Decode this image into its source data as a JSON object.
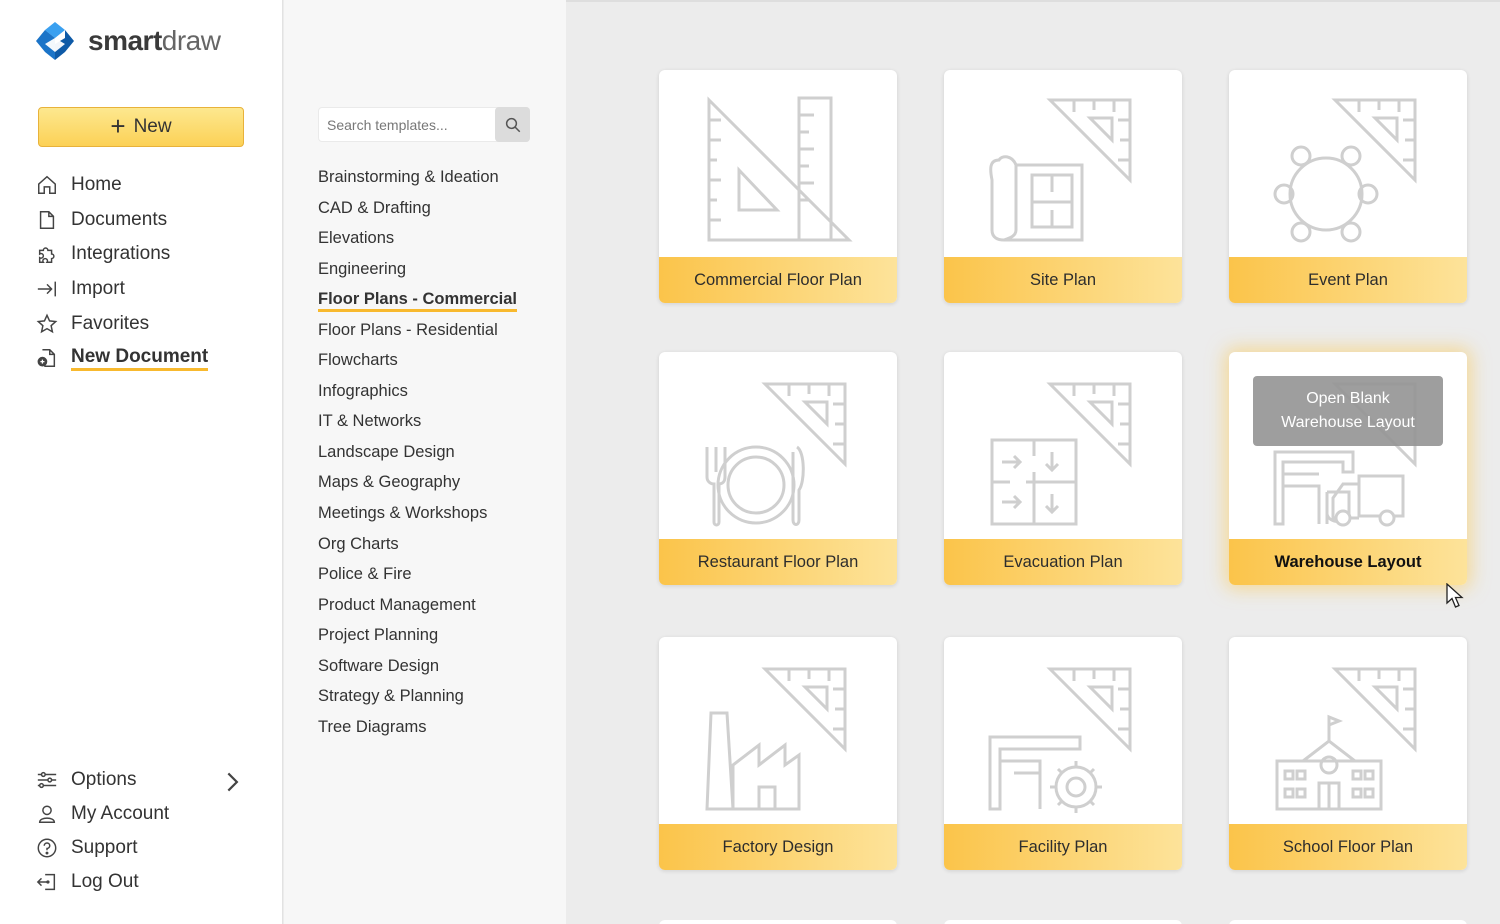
{
  "app": {
    "logo_bold": "smart",
    "logo_light": "draw",
    "brand_colors": {
      "accent": "#fcd156",
      "underline": "#f8b92e",
      "logo_blue": "#1b74c8"
    }
  },
  "sidebar": {
    "new_label": "New",
    "items": [
      {
        "label": "Home",
        "icon": "home-icon"
      },
      {
        "label": "Documents",
        "icon": "document-icon"
      },
      {
        "label": "Integrations",
        "icon": "puzzle-icon"
      },
      {
        "label": "Import",
        "icon": "import-icon"
      },
      {
        "label": "Favorites",
        "icon": "star-icon"
      },
      {
        "label": "New Document",
        "icon": "new-document-icon",
        "active": true
      }
    ],
    "bottom": [
      {
        "label": "Options",
        "icon": "sliders-icon"
      },
      {
        "label": "My Account",
        "icon": "user-icon"
      },
      {
        "label": "Support",
        "icon": "help-icon"
      },
      {
        "label": "Log Out",
        "icon": "logout-icon"
      }
    ]
  },
  "search": {
    "placeholder": "Search templates..."
  },
  "categories": [
    "Brainstorming & Ideation",
    "CAD & Drafting",
    "Elevations",
    "Engineering",
    "Floor Plans - Commercial",
    "Floor Plans - Residential",
    "Flowcharts",
    "Infographics",
    "IT & Networks",
    "Landscape Design",
    "Maps & Geography",
    "Meetings & Workshops",
    "Org Charts",
    "Police & Fire",
    "Product Management",
    "Project Planning",
    "Software Design",
    "Strategy & Planning",
    "Tree Diagrams"
  ],
  "active_category": "Floor Plans - Commercial",
  "templates": [
    {
      "label": "Commercial Floor Plan",
      "icon": "triangle-ruler-icon"
    },
    {
      "label": "Site Plan",
      "icon": "blueprint-icon"
    },
    {
      "label": "Event Plan",
      "icon": "round-table-icon"
    },
    {
      "label": "Restaurant Floor Plan",
      "icon": "plate-cutlery-icon"
    },
    {
      "label": "Evacuation Plan",
      "icon": "evacuation-arrows-icon"
    },
    {
      "label": "Warehouse Layout",
      "icon": "warehouse-truck-icon",
      "hover": true
    },
    {
      "label": "Factory Design",
      "icon": "factory-icon"
    },
    {
      "label": "Facility Plan",
      "icon": "facility-gear-icon"
    },
    {
      "label": "School Floor Plan",
      "icon": "school-icon"
    }
  ],
  "tooltip": {
    "line1": "Open Blank",
    "line2": "Warehouse Layout"
  }
}
